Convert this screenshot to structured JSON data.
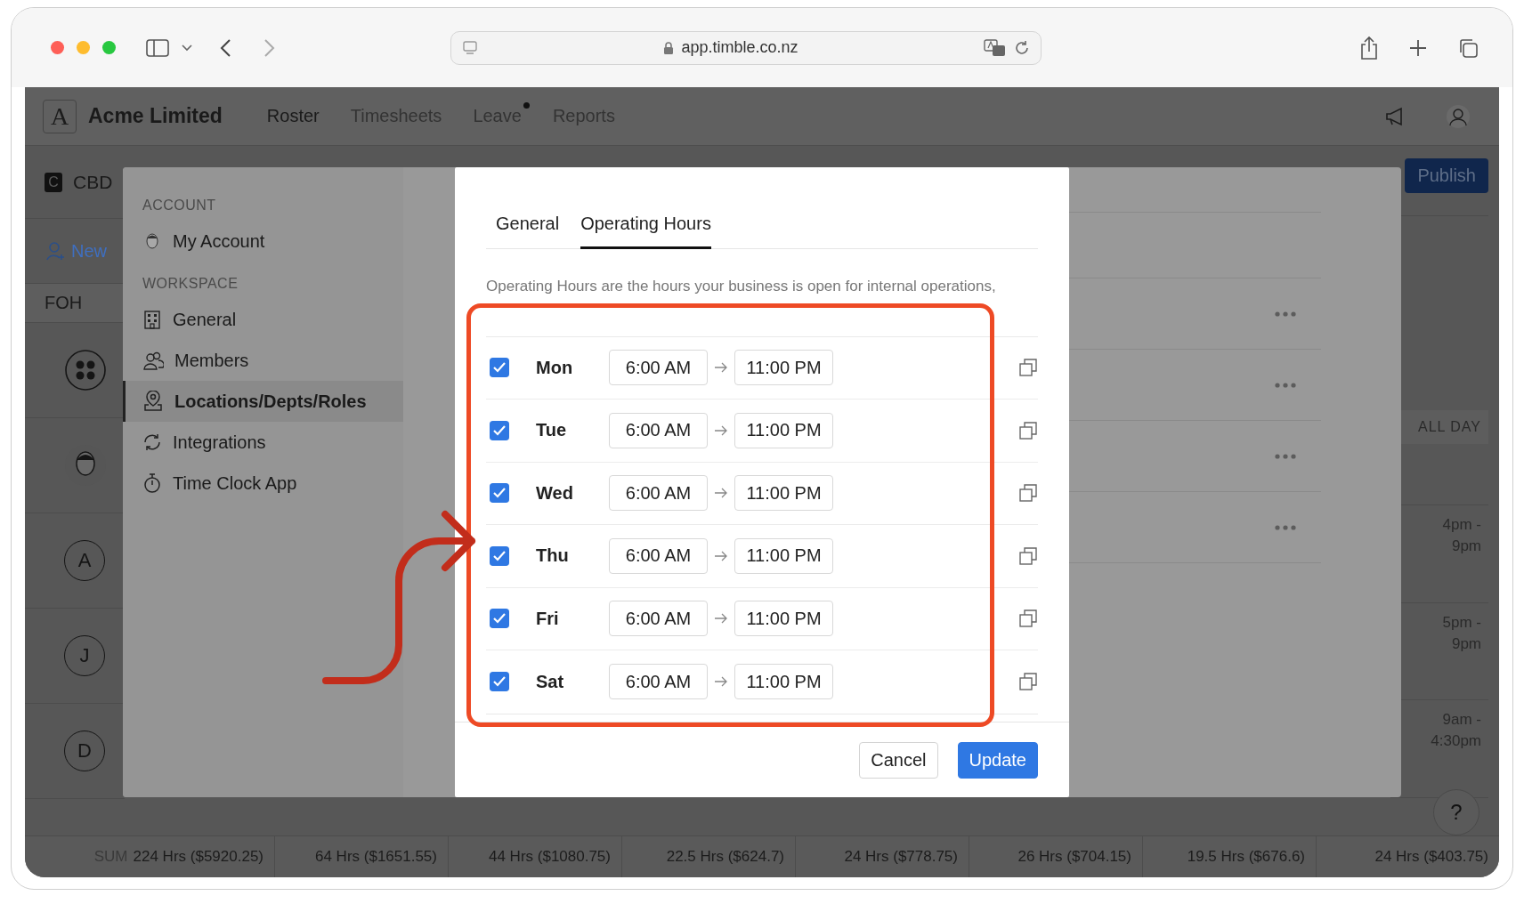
{
  "browser": {
    "url": "app.timble.co.nz"
  },
  "app": {
    "company": "Acme Limited",
    "logo": "A",
    "nav": [
      {
        "label": "Roster",
        "selected": true,
        "dot": false
      },
      {
        "label": "Timesheets",
        "selected": false,
        "dot": false
      },
      {
        "label": "Leave",
        "selected": false,
        "dot": true
      },
      {
        "label": "Reports",
        "selected": false,
        "dot": false
      }
    ]
  },
  "roster": {
    "location_badge": "C",
    "location": "CBD",
    "new_link": "New",
    "department": "FOH",
    "avatars": [
      {
        "kind": "group"
      },
      {
        "kind": "photo"
      },
      {
        "kind": "letter",
        "letter": "A"
      },
      {
        "kind": "letter",
        "letter": "J"
      },
      {
        "kind": "letter",
        "letter": "D"
      }
    ],
    "publish": "Publish",
    "all_day": "ALL DAY",
    "shifts": [
      {
        "lines": [
          "4pm -",
          "9pm"
        ]
      },
      {
        "lines": [
          "5pm -",
          "9pm"
        ]
      },
      {
        "lines": [
          "9am -",
          "4:30pm"
        ]
      }
    ],
    "help": "?",
    "sums": [
      {
        "label": "SUM",
        "value": "224 Hrs ($5920.25)"
      },
      {
        "value": "64 Hrs ($1651.55)"
      },
      {
        "value": "44 Hrs ($1080.75)"
      },
      {
        "value": "22.5 Hrs ($624.7)"
      },
      {
        "value": "24 Hrs ($778.75)"
      },
      {
        "value": "26 Hrs ($704.15)"
      },
      {
        "value": "19.5 Hrs ($676.6)"
      },
      {
        "value": "24 Hrs ($403.75)"
      }
    ]
  },
  "settings": {
    "sections": [
      {
        "title": "ACCOUNT",
        "items": [
          {
            "label": "My Account",
            "selected": false
          }
        ]
      },
      {
        "title": "WORKSPACE",
        "items": [
          {
            "label": "General",
            "selected": false
          },
          {
            "label": "Members",
            "selected": false
          },
          {
            "label": "Locations/Depts/Roles",
            "selected": true
          },
          {
            "label": "Integrations",
            "selected": false
          },
          {
            "label": "Time Clock App",
            "selected": false
          }
        ]
      }
    ]
  },
  "modal": {
    "tabs": [
      {
        "label": "General",
        "selected": false
      },
      {
        "label": "Operating Hours",
        "selected": true
      }
    ],
    "description": "Operating Hours are the hours your business is open for internal operations,",
    "days": [
      {
        "day": "Mon",
        "checked": true,
        "start": "6:00 AM",
        "end": "11:00 PM"
      },
      {
        "day": "Tue",
        "checked": true,
        "start": "6:00 AM",
        "end": "11:00 PM"
      },
      {
        "day": "Wed",
        "checked": true,
        "start": "6:00 AM",
        "end": "11:00 PM"
      },
      {
        "day": "Thu",
        "checked": true,
        "start": "6:00 AM",
        "end": "11:00 PM"
      },
      {
        "day": "Fri",
        "checked": true,
        "start": "6:00 AM",
        "end": "11:00 PM"
      },
      {
        "day": "Sat",
        "checked": true,
        "start": "6:00 AM",
        "end": "11:00 PM"
      }
    ],
    "buttons": [
      {
        "label": "Cancel",
        "kind": "secondary"
      },
      {
        "label": "Update",
        "kind": "primary"
      }
    ]
  }
}
